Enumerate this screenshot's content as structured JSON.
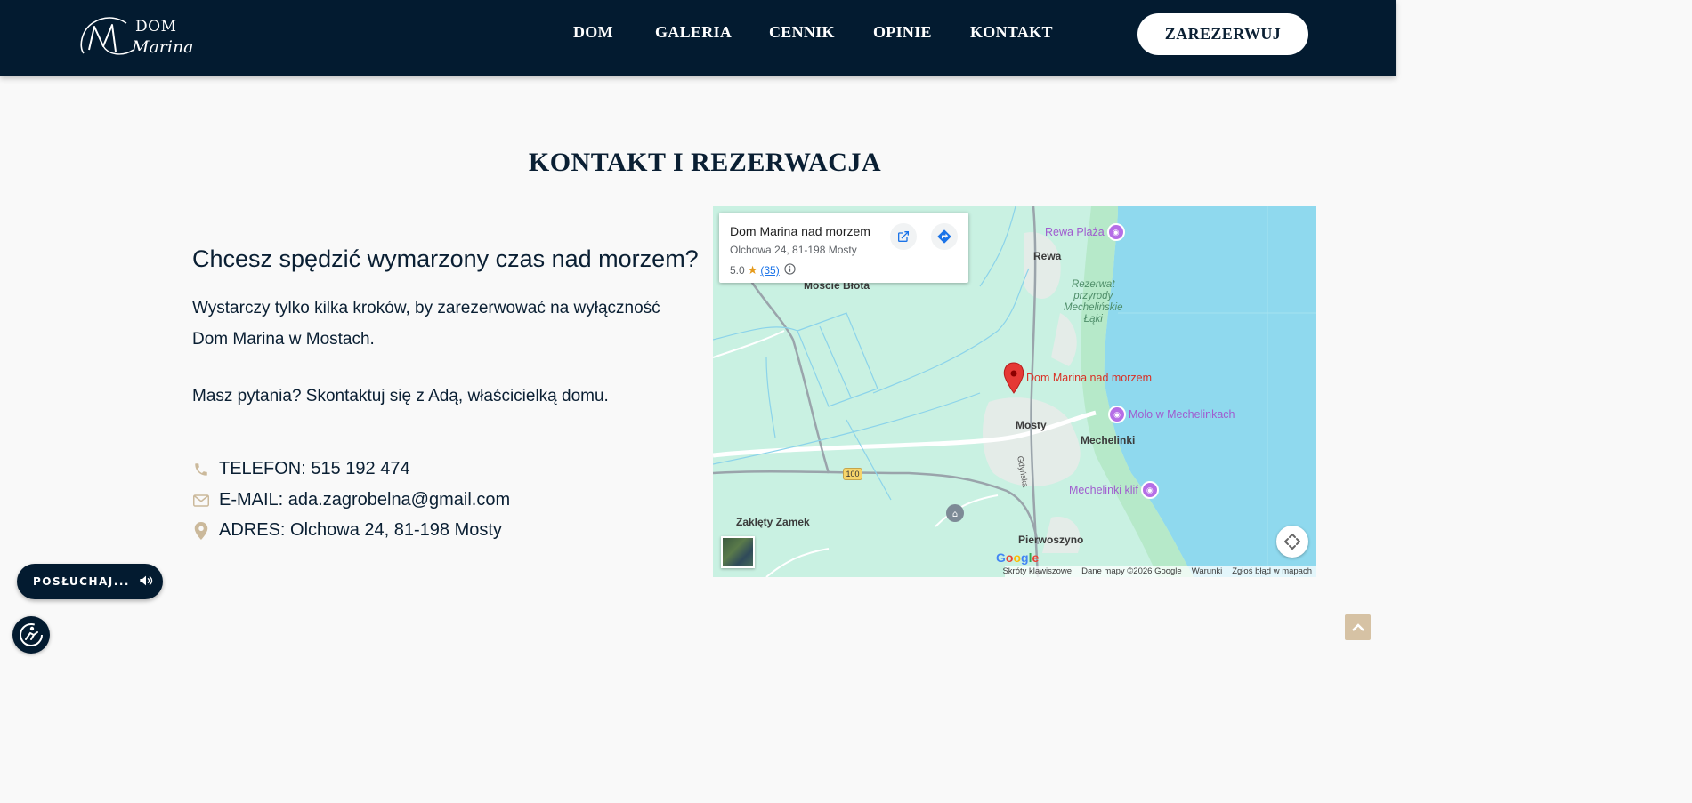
{
  "header": {
    "logo": {
      "line1": "DOM",
      "line2": "Marina"
    },
    "nav": [
      {
        "label": "DOM"
      },
      {
        "label": "GALERIA"
      },
      {
        "label": "CENNIK"
      },
      {
        "label": "OPINIE"
      },
      {
        "label": "KONTAKT"
      }
    ],
    "cta_label": "ZAREZERWUJ"
  },
  "section": {
    "title": "KONTAKT I REZERWACJA",
    "lead": "Chcesz spędzić wymarzony czas nad morzem?",
    "paragraph1": "Wystarczy tylko kilka kroków, by zarezerwować na wyłączność Dom Marina w Mostach.",
    "paragraph2": "Masz pytania? Skontaktuj się z Adą, właścicielką domu.",
    "contacts": [
      {
        "icon": "phone-icon",
        "text": "TELEFON: 515 192 474"
      },
      {
        "icon": "mail-icon",
        "text": "E-MAIL: ada.zagrobelna@gmail.com"
      },
      {
        "icon": "pin-icon",
        "text": "ADRES: Olchowa 24, 81-198 Mosty"
      }
    ]
  },
  "map": {
    "card": {
      "name": "Dom Marina nad morzem",
      "address": "Olchowa 24, 81-198 Mosty",
      "rating": "5.0",
      "reviews": "(35)"
    },
    "labels": {
      "moscie_bloto": "Moście Błota",
      "rewa": "Rewa",
      "reserve": "Rezerwat\nprzyrody\nMechelińskie\nŁąki",
      "mosty": "Mosty",
      "mechelinki": "Mechelinki",
      "zaklety": "Zaklęty Zamek",
      "pierwoszyno": "Pierwoszyno",
      "gdynska": "Gdyńska",
      "road": "100"
    },
    "pois": {
      "rewa_plaza": "Rewa Plaża",
      "molo": "Molo w Mechelinkach",
      "klif": "Mechelinki klif",
      "marker": "Dom Marina nad morzem"
    },
    "google": "Google",
    "footer": [
      "Skróty klawiszowe",
      "Dane mapy ©2026 Google",
      "Warunki",
      "Zgłoś błąd w mapach"
    ]
  },
  "widgets": {
    "listen_label": "POSŁUCHAJ..."
  },
  "colors": {
    "navy": "#031b30",
    "beige": "#d6c2a4",
    "map_land": "#c9f1e2",
    "map_water": "#8fd9ee"
  }
}
